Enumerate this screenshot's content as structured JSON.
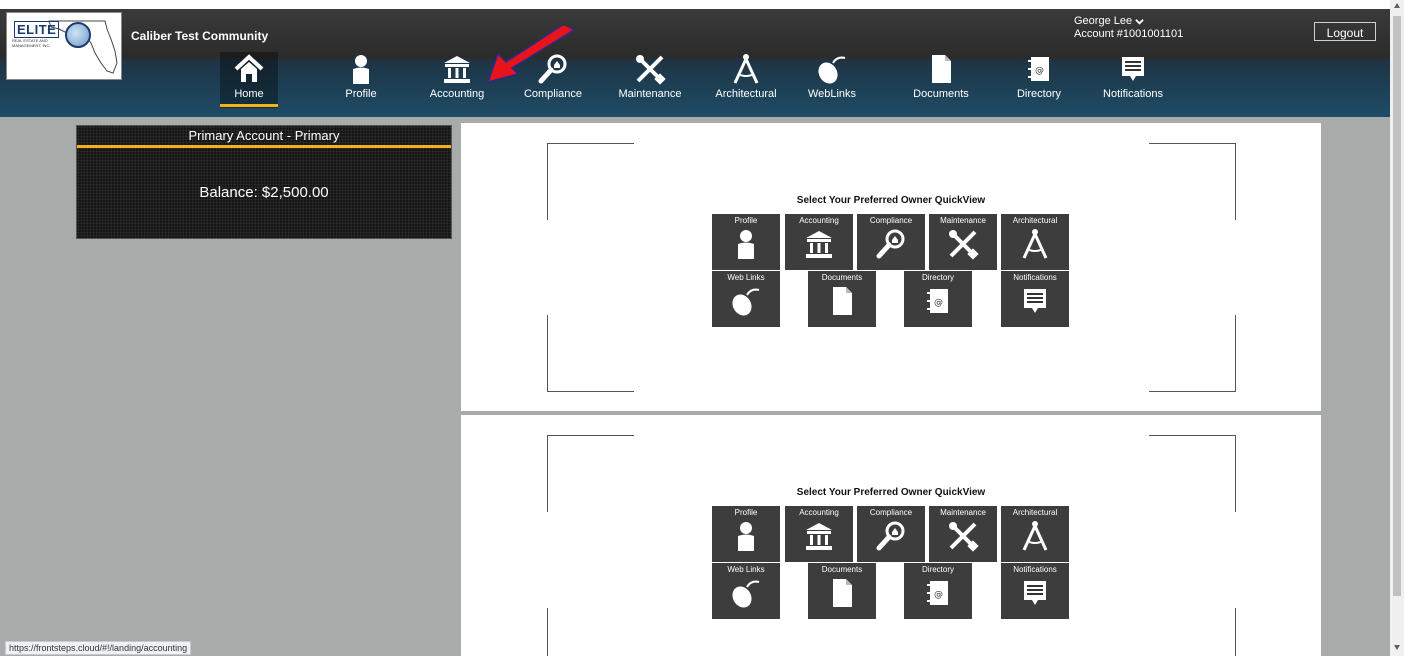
{
  "header": {
    "logo": {
      "text": "ELITE",
      "subtext": "REAL ESTATE AND MANAGEMENT, INC.",
      "icon": "elite-logo"
    },
    "community": "Caliber Test Community",
    "user": {
      "name": "George Lee",
      "account": "Account #1001001101"
    },
    "logout_label": "Logout"
  },
  "nav": {
    "items": [
      {
        "label": "Home",
        "icon": "home-icon",
        "active": true
      },
      {
        "label": "Profile",
        "icon": "person-icon"
      },
      {
        "label": "Accounting",
        "icon": "bank-icon"
      },
      {
        "label": "Compliance",
        "icon": "magnifier-icon"
      },
      {
        "label": "Maintenance",
        "icon": "tools-icon"
      },
      {
        "label": "Architectural",
        "icon": "compass-icon"
      },
      {
        "label": "WebLinks",
        "icon": "mouse-icon"
      },
      {
        "label": "Documents",
        "icon": "document-icon"
      },
      {
        "label": "Directory",
        "icon": "address-book-icon"
      },
      {
        "label": "Notifications",
        "icon": "message-icon"
      }
    ]
  },
  "account": {
    "title": "Primary Account - Primary",
    "balance": "Balance: $2,500.00"
  },
  "quickview": {
    "title": "Select Your Preferred Owner QuickView",
    "tiles": [
      {
        "label": "Profile",
        "icon": "person-icon"
      },
      {
        "label": "Accounting",
        "icon": "bank-icon"
      },
      {
        "label": "Compliance",
        "icon": "magnifier-icon"
      },
      {
        "label": "Maintenance",
        "icon": "tools-icon"
      },
      {
        "label": "Architectural",
        "icon": "compass-icon"
      },
      {
        "label": "Web Links",
        "icon": "mouse-icon"
      },
      {
        "label": "Documents",
        "icon": "document-icon"
      },
      {
        "label": "Directory",
        "icon": "address-book-icon"
      },
      {
        "label": "Notifications",
        "icon": "message-icon"
      }
    ]
  },
  "status_url": "https://frontsteps.cloud/#!/landing/accounting",
  "colors": {
    "accent": "#f2b21c",
    "annotation_arrow": "#e8141c"
  }
}
